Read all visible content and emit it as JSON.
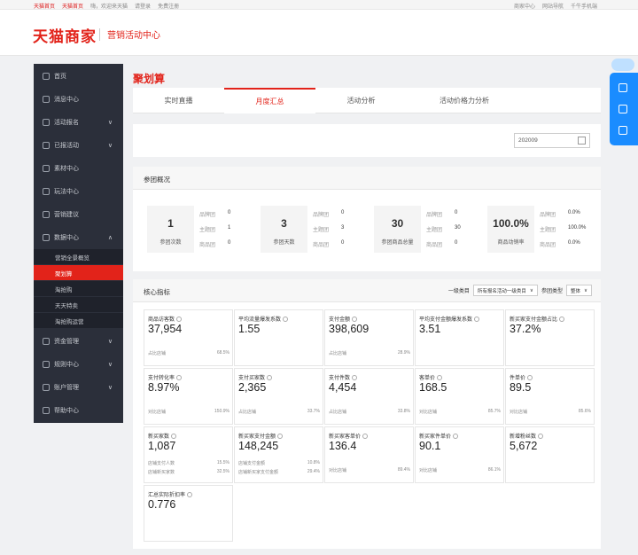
{
  "topbar": {
    "left": [
      "天猫首页",
      "天猫首页",
      "嗨，欢迎来天猫",
      "请登录",
      "免费注册"
    ],
    "right": [
      "商家中心",
      "网站导航",
      "千牛手机端"
    ]
  },
  "header": {
    "logo": "天猫商家",
    "subtitle": "营销活动中心"
  },
  "sidebar": {
    "items": [
      {
        "label": "首页",
        "chevron": ""
      },
      {
        "label": "消息中心",
        "chevron": ""
      },
      {
        "label": "活动报名",
        "chevron": "∨"
      },
      {
        "label": "已报活动",
        "chevron": "∨"
      },
      {
        "label": "素材中心",
        "chevron": ""
      },
      {
        "label": "玩法中心",
        "chevron": ""
      },
      {
        "label": "营销建议",
        "chevron": ""
      },
      {
        "label": "数据中心",
        "chevron": "∧"
      }
    ],
    "subitems": [
      "营销全景概览",
      "聚划算",
      "淘抢购",
      "天天特卖",
      "淘抢购运营"
    ],
    "items_bottom": [
      {
        "label": "资金管理",
        "chevron": "∨"
      },
      {
        "label": "规则中心",
        "chevron": "∨"
      },
      {
        "label": "账户管理",
        "chevron": "∨"
      },
      {
        "label": "帮助中心",
        "chevron": ""
      }
    ]
  },
  "page": {
    "title": "聚划算",
    "tabs": [
      "实时直播",
      "月度汇总",
      "活动分析",
      "活动价格力分析"
    ],
    "date": "202009"
  },
  "overview": {
    "title": "参团概况",
    "groups": [
      {
        "num": "1",
        "label": "参团次数",
        "rows": [
          [
            "品牌团",
            "0"
          ],
          [
            "主题团",
            "1"
          ],
          [
            "商品团",
            "0"
          ]
        ]
      },
      {
        "num": "3",
        "label": "参团天数",
        "rows": [
          [
            "品牌团",
            "0"
          ],
          [
            "主题团",
            "3"
          ],
          [
            "商品团",
            "0"
          ]
        ]
      },
      {
        "num": "30",
        "label": "参团商品总量",
        "rows": [
          [
            "品牌团",
            "0"
          ],
          [
            "主题团",
            "30"
          ],
          [
            "商品团",
            "0"
          ]
        ]
      },
      {
        "num": "100.0%",
        "label": "商品动销率",
        "rows": [
          [
            "品牌团",
            "0.0%"
          ],
          [
            "主题团",
            "100.0%"
          ],
          [
            "商品团",
            "0.0%"
          ]
        ]
      }
    ]
  },
  "core": {
    "title": "核心指标",
    "filter1_label": "一级类目",
    "filter1_value": "所有报名活动一级类目",
    "filter2_label": "参团类型",
    "filter2_value": "整体",
    "cards": [
      {
        "label": "商品访客数",
        "value": "37,954",
        "subs": [
          [
            "占比店铺",
            "68.5%"
          ]
        ]
      },
      {
        "label": "平均流量爆发系数",
        "value": "1.55",
        "subs": []
      },
      {
        "label": "支付金额",
        "value": "398,609",
        "subs": [
          [
            "占比店铺",
            "28.9%"
          ]
        ]
      },
      {
        "label": "平均支付金额爆发系数",
        "value": "3.51",
        "subs": []
      },
      {
        "label": "新买家支付金额占比",
        "value": "37.2%",
        "subs": []
      },
      {
        "label": "支付转化率",
        "value": "8.97%",
        "subs": [
          [
            "对比店铺",
            "150.9%"
          ]
        ]
      },
      {
        "label": "支付买家数",
        "value": "2,365",
        "subs": [
          [
            "占比店铺",
            "33.7%"
          ]
        ]
      },
      {
        "label": "支付件数",
        "value": "4,454",
        "subs": [
          [
            "占比店铺",
            "33.8%"
          ]
        ]
      },
      {
        "label": "客单价",
        "value": "168.5",
        "subs": [
          [
            "对比店铺",
            "85.7%"
          ]
        ]
      },
      {
        "label": "件单价",
        "value": "89.5",
        "subs": [
          [
            "对比店铺",
            "85.6%"
          ]
        ]
      },
      {
        "label": "新买家数",
        "value": "1,087",
        "subs": [
          [
            "店铺支付人数",
            "15.5%"
          ],
          [
            "店铺新买家数",
            "32.5%"
          ]
        ]
      },
      {
        "label": "新买家支付金额",
        "value": "148,245",
        "subs": [
          [
            "店铺支付金额",
            "10.8%"
          ],
          [
            "店铺新买家支付金额",
            "29.4%"
          ]
        ]
      },
      {
        "label": "新买家客单价",
        "value": "136.4",
        "subs": [
          [
            "对比店铺",
            "89.4%"
          ]
        ]
      },
      {
        "label": "新买家件单价",
        "value": "90.1",
        "subs": [
          [
            "对比店铺",
            "86.1%"
          ]
        ]
      },
      {
        "label": "新增粉丝数",
        "value": "5,672",
        "subs": []
      },
      {
        "label": "汇总实际折扣率",
        "value": "0.776",
        "subs": []
      }
    ]
  },
  "colors": {
    "accent": "#e2231a",
    "sidebar": "#2b2f3a",
    "float": "#1a8cff"
  }
}
